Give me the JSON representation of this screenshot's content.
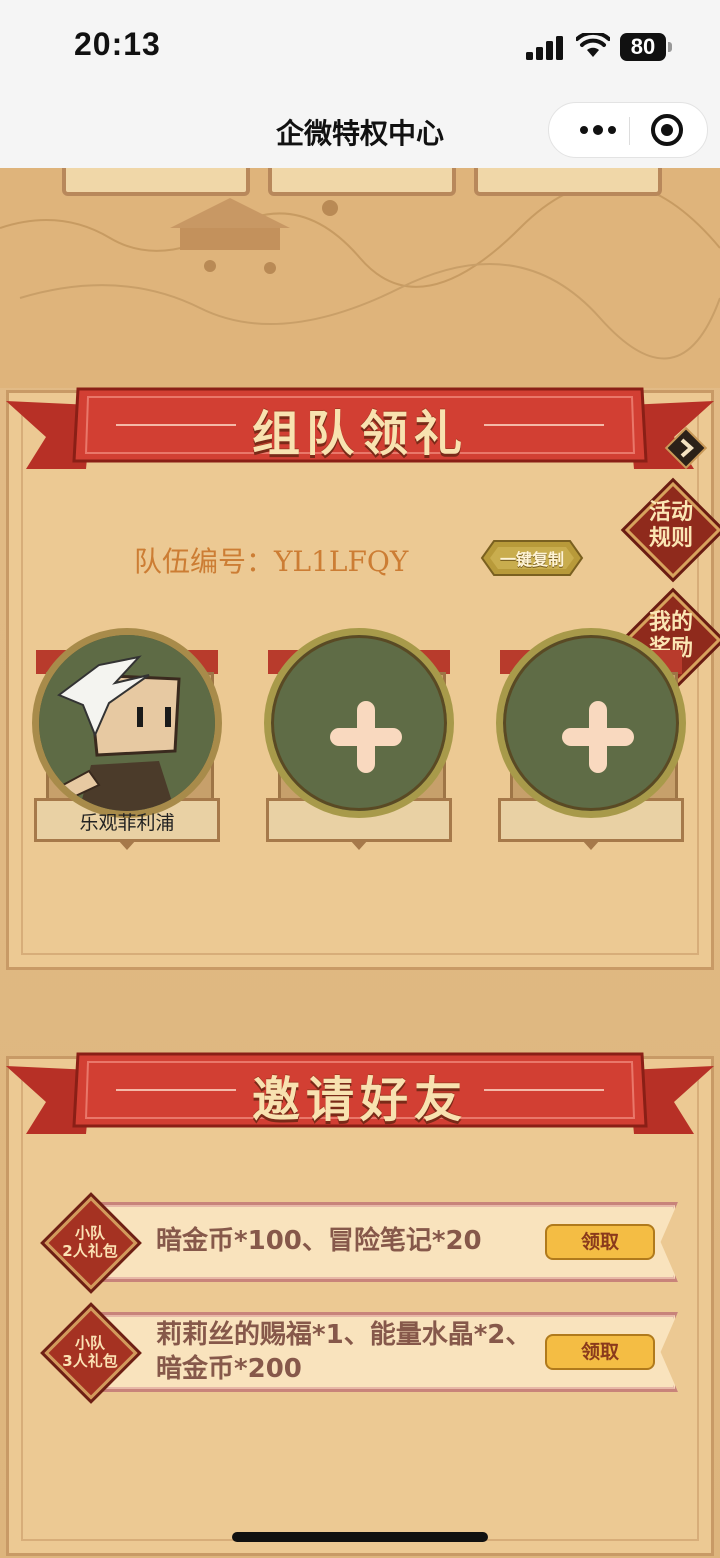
{
  "status_bar": {
    "time": "20:13",
    "battery": "80"
  },
  "nav": {
    "title": "企微特权中心"
  },
  "team_section": {
    "title": "组队领礼",
    "rules_label": "活动\n规则",
    "rewards_label": "我的\n奖励",
    "team_number_text": "队伍编号：YL1LFQY",
    "copy_button": "一键复制",
    "members": [
      {
        "name": "乐观菲利浦"
      },
      {
        "name": ""
      },
      {
        "name": ""
      }
    ]
  },
  "invite_section": {
    "title": "邀请好友",
    "rewards": [
      {
        "tag": "小队\n2人礼包",
        "desc": "暗金币*100、冒险笔记*20",
        "button": "领取"
      },
      {
        "tag": "小队\n3人礼包",
        "desc": "莉莉丝的赐福*1、能量水晶*2、\n暗金币*200",
        "button": "领取"
      }
    ]
  },
  "icons": [
    "signal-icon",
    "wifi-icon",
    "battery-icon",
    "more-icon",
    "close-icon",
    "chevron-right-icon",
    "plus-icon",
    "avatar"
  ]
}
